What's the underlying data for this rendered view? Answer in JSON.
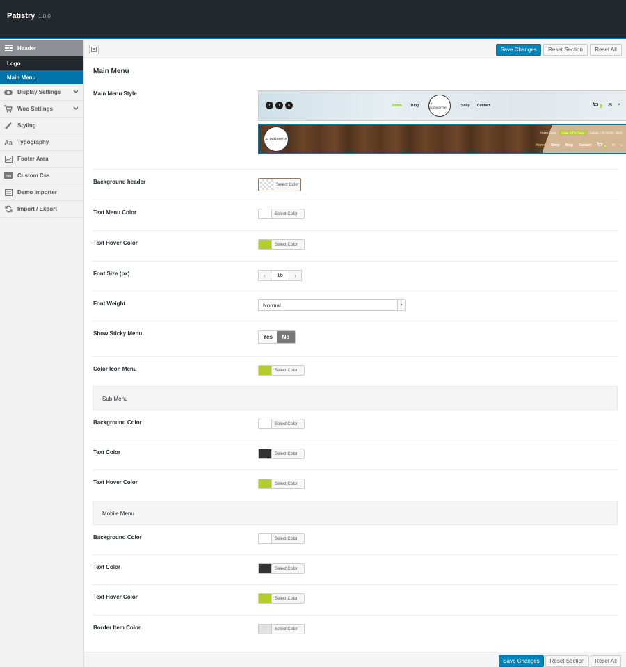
{
  "app": {
    "title": "Patistry",
    "version": "1.0.0"
  },
  "sidebar": {
    "header_label": "Header",
    "subitems": [
      {
        "label": "Logo"
      },
      {
        "label": "Main Menu"
      }
    ],
    "items": [
      {
        "label": "Display Settings",
        "icon": "eye-icon",
        "expandable": true
      },
      {
        "label": "Woo Settings",
        "icon": "cart-icon",
        "expandable": true
      },
      {
        "label": "Styling",
        "icon": "brush-icon"
      },
      {
        "label": "Typography",
        "icon": "typography-icon"
      },
      {
        "label": "Footer Area",
        "icon": "footer-icon"
      },
      {
        "label": "Custom Css",
        "icon": "css-icon"
      },
      {
        "label": "Demo Importer",
        "icon": "importer-icon"
      },
      {
        "label": "Import / Export",
        "icon": "sync-icon"
      }
    ]
  },
  "toolbar": {
    "save_label": "Save Changes",
    "reset_section_label": "Reset Section",
    "reset_all_label": "Reset All"
  },
  "section": {
    "title": "Main Menu",
    "menu_style_label": "Main Menu Style",
    "preview1": {
      "nav": [
        "Home",
        "Blog",
        "Shop",
        "Contact"
      ],
      "logo_text": "la pâtisserie",
      "cart_count": "0"
    },
    "preview2": {
      "hours": "Hours: Open",
      "hours_pill": "Close 10PM Today",
      "call": "Call Us: +00 35 854 78631",
      "nav": [
        "Home",
        "Shop",
        "Blog",
        "Contact"
      ],
      "logo_text": "la pâtisserie",
      "cart_count": "0"
    },
    "fields": [
      {
        "label": "Background header",
        "type": "color",
        "value": "transparent",
        "button": "Select Color"
      },
      {
        "label": "Text Menu Color",
        "type": "color",
        "value": "#ffffff",
        "button": "Select Color"
      },
      {
        "label": "Text Hover Color",
        "type": "color",
        "value": "#b5cc2d",
        "button": "Select Color"
      },
      {
        "label": "Font Size (px)",
        "type": "stepper",
        "value": "16"
      },
      {
        "label": "Font Weight",
        "type": "select",
        "value": "Normal"
      },
      {
        "label": "Show Sticky Menu",
        "type": "toggle",
        "yes": "Yes",
        "no": "No",
        "selected": "No"
      },
      {
        "label": "Color Icon Menu",
        "type": "color",
        "value": "#b5cc2d",
        "button": "Select Color"
      }
    ],
    "sub_menu": {
      "title": "Sub Menu",
      "fields": [
        {
          "label": "Background Color",
          "value": "#ffffff",
          "button": "Select Color"
        },
        {
          "label": "Text Color",
          "value": "#333333",
          "button": "Select Color"
        },
        {
          "label": "Text Hover Color",
          "value": "#b5cc2d",
          "button": "Select Color"
        }
      ]
    },
    "mobile_menu": {
      "title": "Mobile Menu",
      "fields": [
        {
          "label": "Background Color",
          "value": "#ffffff",
          "button": "Select Color"
        },
        {
          "label": "Text Color",
          "value": "#333333",
          "button": "Select Color"
        },
        {
          "label": "Text Hover Color",
          "value": "#b5cc2d",
          "button": "Select Color"
        },
        {
          "label": "Border Item Color",
          "value": "#e1e1e1",
          "button": "Select Color"
        }
      ]
    }
  },
  "colors": {
    "accent": "#0085ba",
    "topbar": "#23282d",
    "green": "#b5cc2d"
  }
}
